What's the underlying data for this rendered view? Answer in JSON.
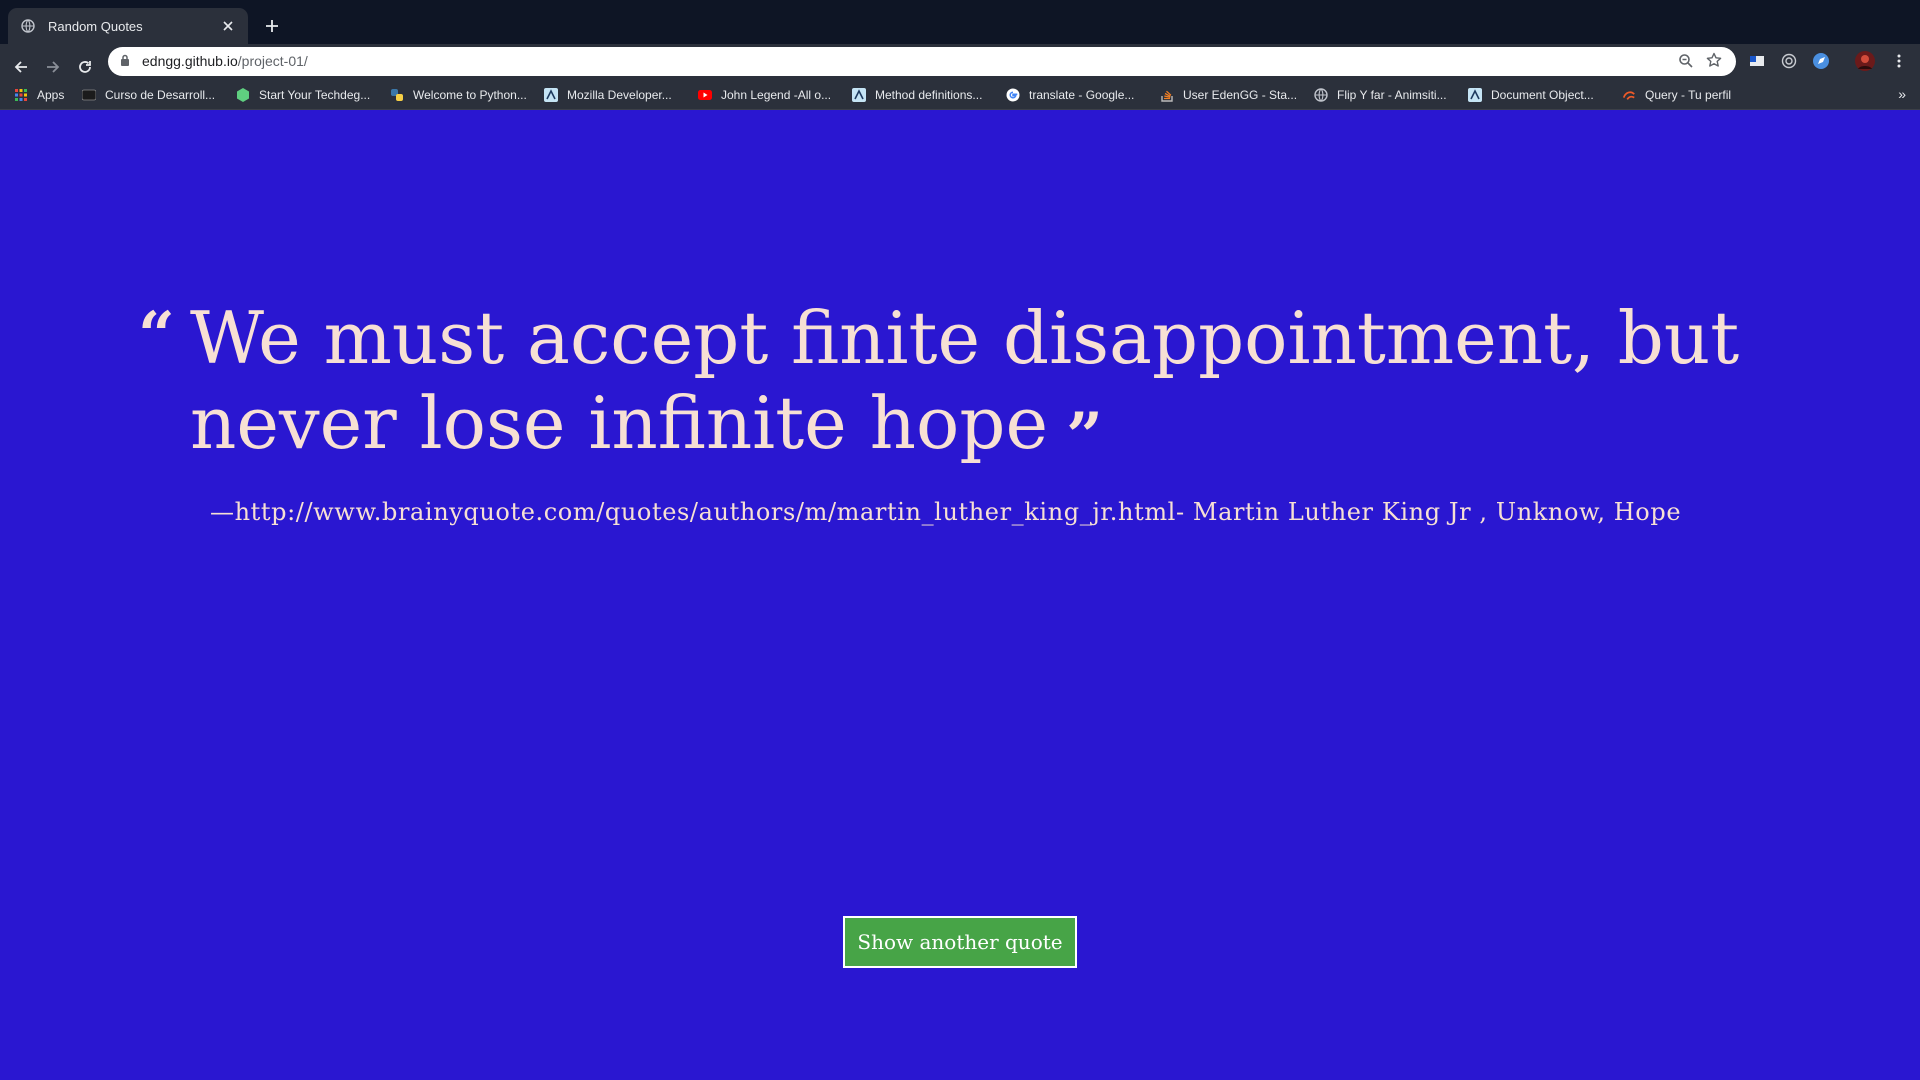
{
  "browser": {
    "tab_title": "Random Quotes",
    "url_host": "edngg.github.io",
    "url_path": "/project-01/",
    "bookmarks": [
      {
        "label": "Apps",
        "icon": "apps-grid-icon"
      },
      {
        "label": "Curso de Desarroll...",
        "icon": "bookmark-site-icon"
      },
      {
        "label": "Start Your Techdeg...",
        "icon": "treehouse-icon"
      },
      {
        "label": "Welcome to Python...",
        "icon": "python-icon"
      },
      {
        "label": "Mozilla Developer...",
        "icon": "mdn-icon"
      },
      {
        "label": "John Legend -All o...",
        "icon": "youtube-icon"
      },
      {
        "label": "Method definitions...",
        "icon": "mdn-icon"
      },
      {
        "label": "translate - Google...",
        "icon": "google-icon"
      },
      {
        "label": "User EdenGG - Sta...",
        "icon": "stackoverflow-icon"
      },
      {
        "label": "Flip Y far - Animsiti...",
        "icon": "globe-icon"
      },
      {
        "label": "Document Object...",
        "icon": "mdn-icon"
      },
      {
        "label": "Query - Tu perfil",
        "icon": "query-icon"
      }
    ],
    "bookmarks_more": "»"
  },
  "page": {
    "open_quote": "“",
    "quote_text": "We must accept finite disappointment, but never lose infinite hope",
    "close_quote": "”",
    "source": "—http://www.brainyquote.com/quotes/authors/m/martin_luther_king_jr.html- Martin Luther King Jr , Unknow, Hope",
    "button_label": "Show another quote"
  },
  "colors": {
    "page_background": "#2a17d1",
    "quote_text": "#f7e0d4",
    "button_background": "#47a447"
  }
}
